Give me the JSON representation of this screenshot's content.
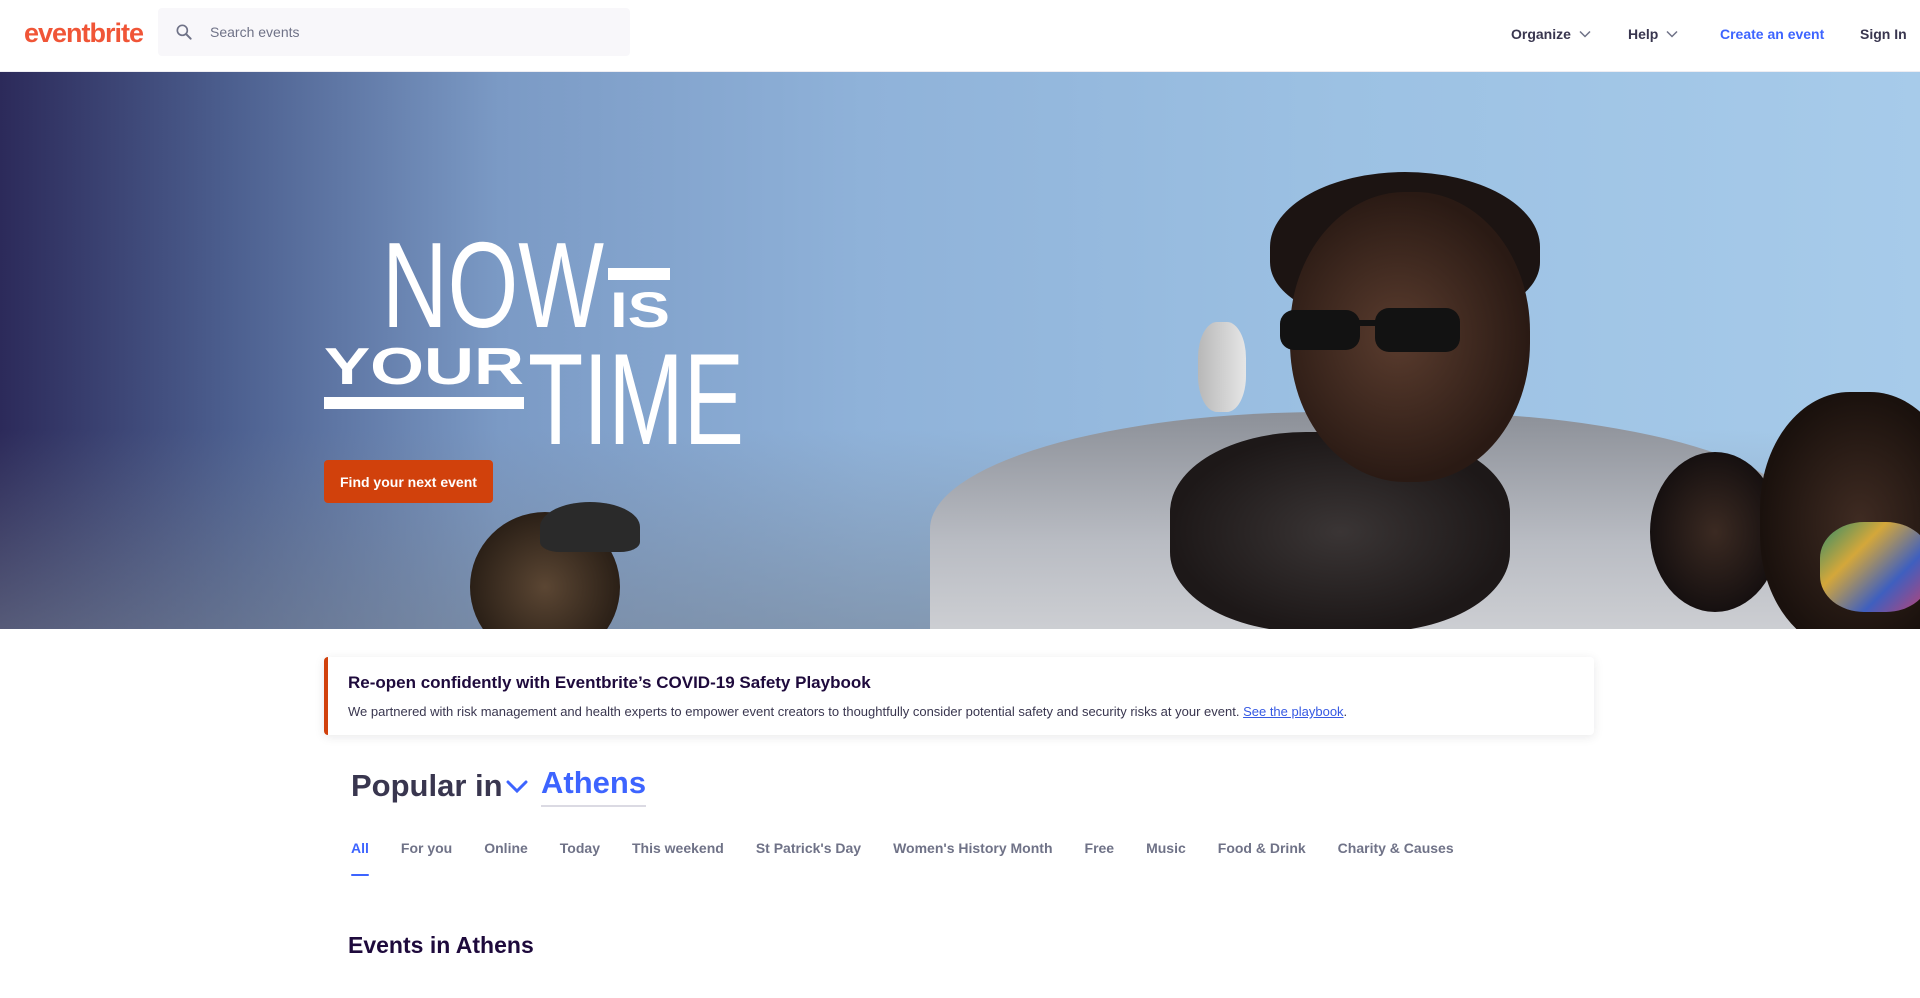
{
  "header": {
    "logo": "eventbrite",
    "search_placeholder": "Search events",
    "nav": {
      "organize": "Organize",
      "help": "Help",
      "create_event": "Create an event",
      "sign_in": "Sign In"
    }
  },
  "hero": {
    "title_line1_a": "NOW",
    "title_line1_b": "IS",
    "title_line2_a": "YOUR",
    "title_line2_b": "TIME",
    "cta_label": "Find your next event"
  },
  "covid": {
    "title": "Re-open confidently with Eventbrite’s COVID-19 Safety Playbook",
    "text": "We partnered with risk management and health experts to empower event creators to thoughtfully consider potential safety and security risks at your event.",
    "link_label": "See the playbook",
    "trailing": "."
  },
  "popular": {
    "label": "Popular in",
    "city": "Athens"
  },
  "tabs": [
    {
      "label": "All",
      "active": true
    },
    {
      "label": "For you"
    },
    {
      "label": "Online"
    },
    {
      "label": "Today"
    },
    {
      "label": "This weekend"
    },
    {
      "label": "St Patrick's Day"
    },
    {
      "label": "Women's History Month"
    },
    {
      "label": "Free"
    },
    {
      "label": "Music"
    },
    {
      "label": "Food & Drink"
    },
    {
      "label": "Charity & Causes"
    }
  ],
  "events": {
    "heading": "Events in Athens"
  },
  "colors": {
    "brand": "#f05537",
    "cta": "#d1410c",
    "accent": "#3d64ff",
    "text": "#1e0a3c"
  },
  "icons": {
    "search": "search-icon",
    "chevron": "chevron-down-icon"
  }
}
